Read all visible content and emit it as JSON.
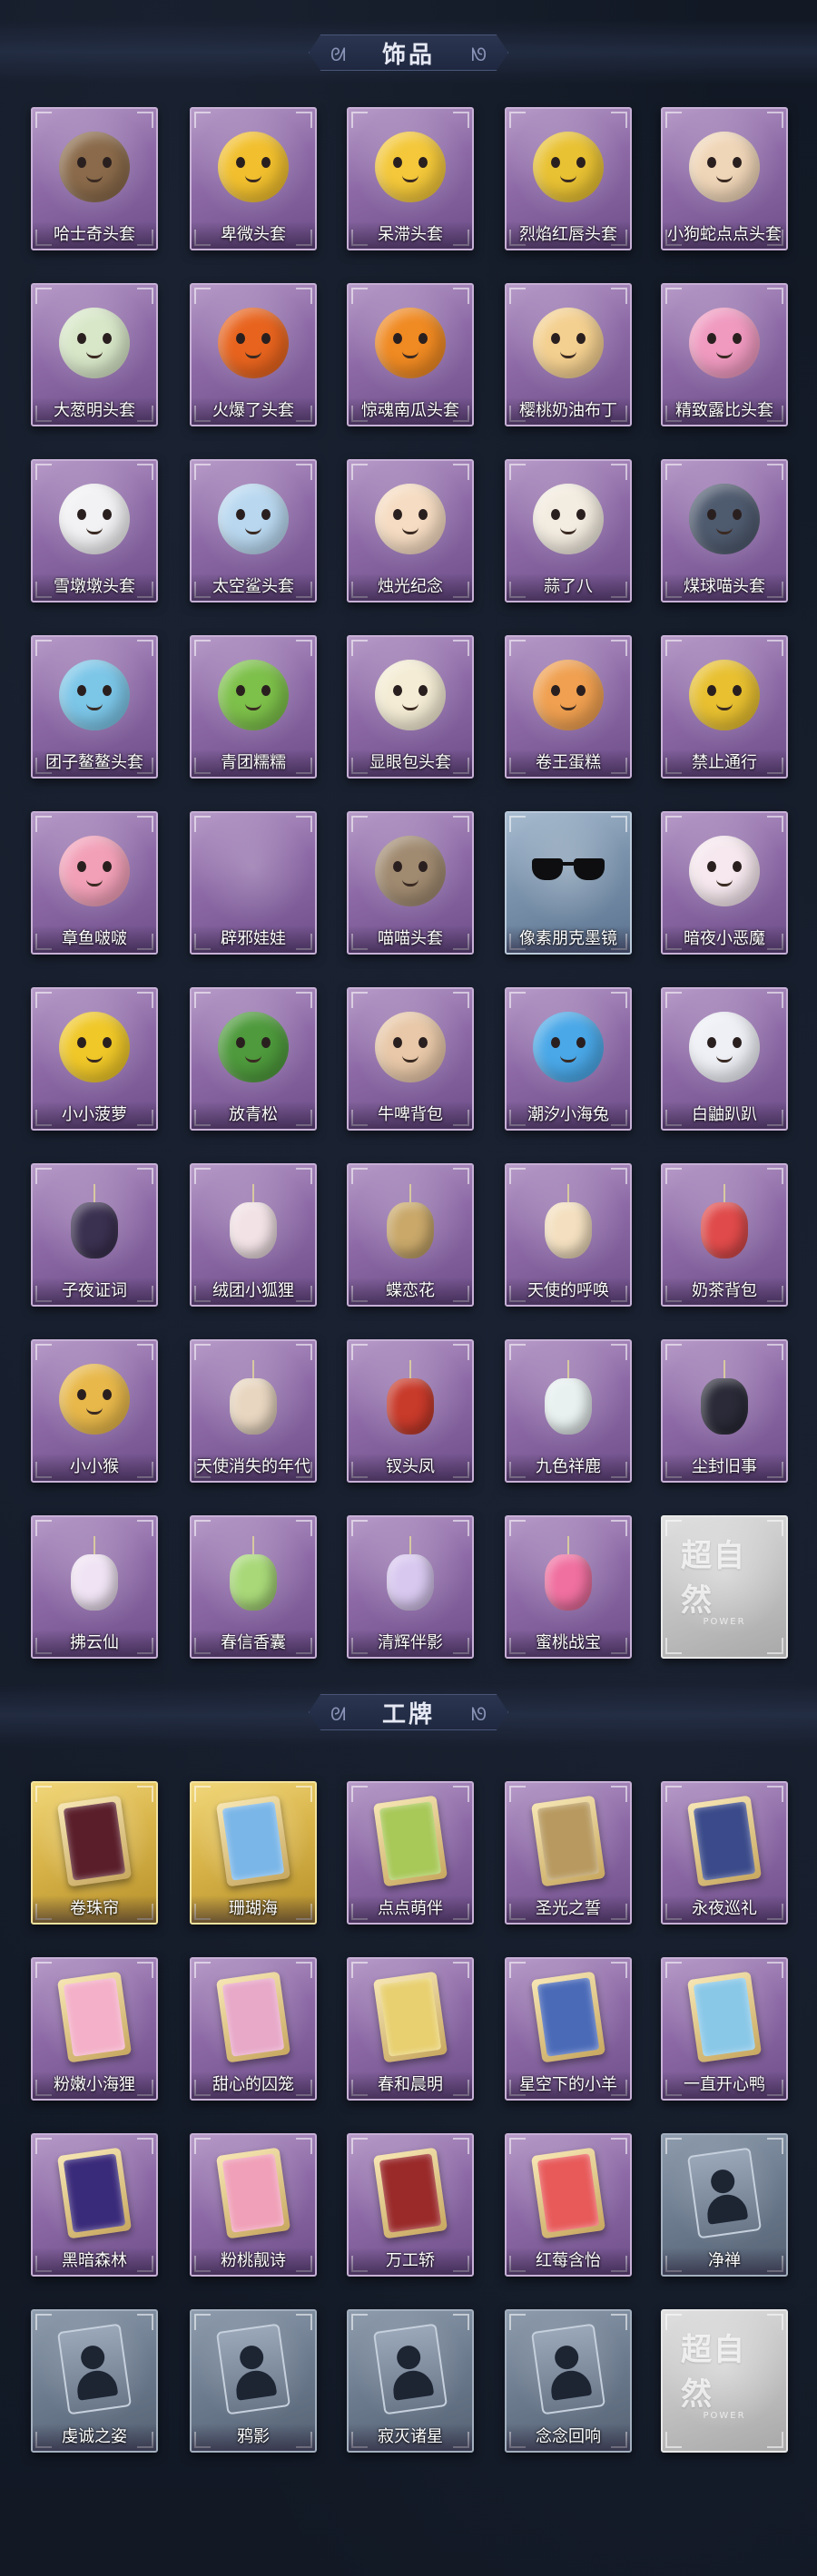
{
  "sections": {
    "accessories": {
      "title": "饰品",
      "items": [
        {
          "label": "哈士奇头套",
          "frame": "purple",
          "art": "blob",
          "color": "#8a6a4a"
        },
        {
          "label": "卑微头套",
          "frame": "purple",
          "art": "blob",
          "color": "#f2c02e"
        },
        {
          "label": "呆滞头套",
          "frame": "purple",
          "art": "blob",
          "color": "#f4c83a"
        },
        {
          "label": "烈焰红唇头套",
          "frame": "purple",
          "art": "blob",
          "color": "#e9c233"
        },
        {
          "label": "小狗蛇点点头套",
          "frame": "purple",
          "art": "blob",
          "color": "#f0d6b8"
        },
        {
          "label": "大葱明头套",
          "frame": "purple",
          "art": "blob",
          "color": "#d8e7c8"
        },
        {
          "label": "火爆了头套",
          "frame": "purple",
          "art": "blob",
          "color": "#e8641e"
        },
        {
          "label": "惊魂南瓜头套",
          "frame": "purple",
          "art": "blob",
          "color": "#f08a22"
        },
        {
          "label": "樱桃奶油布丁",
          "frame": "purple",
          "art": "blob",
          "color": "#f4d090"
        },
        {
          "label": "精致露比头套",
          "frame": "purple",
          "art": "blob",
          "color": "#f09ac0"
        },
        {
          "label": "雪墩墩头套",
          "frame": "purple",
          "art": "blob",
          "color": "#f2f2f4"
        },
        {
          "label": "太空鲨头套",
          "frame": "purple",
          "art": "blob",
          "color": "#b9d8f0"
        },
        {
          "label": "烛光纪念",
          "frame": "purple",
          "art": "blob",
          "color": "#f6dcc2"
        },
        {
          "label": "蒜了八",
          "frame": "purple",
          "art": "blob",
          "color": "#f3ece0"
        },
        {
          "label": "煤球喵头套",
          "frame": "purple",
          "art": "blob",
          "color": "#4e5a6e"
        },
        {
          "label": "团子鳌鳌头套",
          "frame": "purple",
          "art": "blob",
          "color": "#7cc6e8"
        },
        {
          "label": "青团糯糯",
          "frame": "purple",
          "art": "blob",
          "color": "#7dc04a"
        },
        {
          "label": "显眼包头套",
          "frame": "purple",
          "art": "blob",
          "color": "#f4ecd4"
        },
        {
          "label": "卷王蛋糕",
          "frame": "purple",
          "art": "blob",
          "color": "#f0a050"
        },
        {
          "label": "禁止通行",
          "frame": "purple",
          "art": "blob",
          "color": "#e8c030"
        },
        {
          "label": "章鱼啵啵",
          "frame": "purple",
          "art": "blob",
          "color": "#f2a0b8"
        },
        {
          "label": "辟邪娃娃",
          "frame": "purple",
          "art": "none",
          "color": "#a98cbf"
        },
        {
          "label": "喵喵头套",
          "frame": "purple",
          "art": "blob",
          "color": "#a08a70"
        },
        {
          "label": "像素朋克墨镜",
          "frame": "blue",
          "art": "sunglasses",
          "color": "#0e0e10"
        },
        {
          "label": "暗夜小恶魔",
          "frame": "purple",
          "art": "blob",
          "color": "#f6e8ee"
        },
        {
          "label": "小小菠萝",
          "frame": "purple",
          "art": "blob",
          "color": "#f0c828"
        },
        {
          "label": "放青松",
          "frame": "purple",
          "art": "blob",
          "color": "#4e9a3c"
        },
        {
          "label": "牛啤背包",
          "frame": "purple",
          "art": "blob",
          "color": "#e8c8a8"
        },
        {
          "label": "潮汐小海兔",
          "frame": "purple",
          "art": "blob",
          "color": "#4aa8e8"
        },
        {
          "label": "白鼬趴趴",
          "frame": "purple",
          "art": "blob",
          "color": "#eef0f6"
        },
        {
          "label": "子夜证词",
          "frame": "purple",
          "art": "pendant",
          "color": "#3a3050"
        },
        {
          "label": "绒团小狐狸",
          "frame": "purple",
          "art": "pendant",
          "color": "#f2e2e6"
        },
        {
          "label": "蝶恋花",
          "frame": "purple",
          "art": "pendant",
          "color": "#c9a86a"
        },
        {
          "label": "天使的呼唤",
          "frame": "purple",
          "art": "pendant",
          "color": "#f4e0c0"
        },
        {
          "label": "奶茶背包",
          "frame": "purple",
          "art": "pendant",
          "color": "#e04a4a"
        },
        {
          "label": "小小猴",
          "frame": "purple",
          "art": "blob",
          "color": "#e8b84a"
        },
        {
          "label": "天使消失的年代",
          "frame": "purple",
          "art": "pendant",
          "color": "#e8d6c0"
        },
        {
          "label": "钗头凤",
          "frame": "purple",
          "art": "pendant",
          "color": "#c83a2a"
        },
        {
          "label": "九色祥鹿",
          "frame": "purple",
          "art": "pendant",
          "color": "#e8f0f0"
        },
        {
          "label": "尘封旧事",
          "frame": "purple",
          "art": "pendant",
          "color": "#2a2a38"
        },
        {
          "label": "拂云仙",
          "frame": "purple",
          "art": "pendant",
          "color": "#f0e4f4"
        },
        {
          "label": "春信香囊",
          "frame": "purple",
          "art": "pendant",
          "color": "#a8d878"
        },
        {
          "label": "清辉伴影",
          "frame": "purple",
          "art": "pendant",
          "color": "#d8c8f0"
        },
        {
          "label": "蜜桃战宝",
          "frame": "purple",
          "art": "pendant",
          "color": "#f070a0"
        },
        {
          "label": "",
          "frame": "gray",
          "art": "watermark",
          "color": "#ffffff"
        }
      ]
    },
    "badges": {
      "title": "工牌",
      "items": [
        {
          "label": "卷珠帘",
          "frame": "gold",
          "art": "card",
          "color": "#5a1e2a"
        },
        {
          "label": "珊瑚海",
          "frame": "gold",
          "art": "card",
          "color": "#7ab6e8"
        },
        {
          "label": "点点萌伴",
          "frame": "purple",
          "art": "card",
          "color": "#a8c858"
        },
        {
          "label": "圣光之誓",
          "frame": "purple",
          "art": "card",
          "color": "#b89a60"
        },
        {
          "label": "永夜巡礼",
          "frame": "purple",
          "art": "card",
          "color": "#3a4a8a"
        },
        {
          "label": "粉嫩小海狸",
          "frame": "purple",
          "art": "card",
          "color": "#f4b0c8"
        },
        {
          "label": "甜心的囚笼",
          "frame": "purple",
          "art": "card",
          "color": "#e8a8c8"
        },
        {
          "label": "春和晨明",
          "frame": "purple",
          "art": "card",
          "color": "#e8d070"
        },
        {
          "label": "星空下的小羊",
          "frame": "purple",
          "art": "card",
          "color": "#4a6ab8"
        },
        {
          "label": "一直开心鸭",
          "frame": "purple",
          "art": "card",
          "color": "#8ac8e8"
        },
        {
          "label": "黑暗森林",
          "frame": "purple",
          "art": "card",
          "color": "#3a2a7a"
        },
        {
          "label": "粉桃靓诗",
          "frame": "purple",
          "art": "card",
          "color": "#f0a0b8"
        },
        {
          "label": "万工轿",
          "frame": "purple",
          "art": "card",
          "color": "#9a2a2a"
        },
        {
          "label": "红莓含怡",
          "frame": "purple",
          "art": "card",
          "color": "#e85a5a"
        },
        {
          "label": "净禅",
          "frame": "slate",
          "art": "silhouette",
          "color": "#1d2533"
        },
        {
          "label": "虔诚之姿",
          "frame": "slate",
          "art": "silhouette",
          "color": "#1d2533"
        },
        {
          "label": "鸦影",
          "frame": "slate",
          "art": "silhouette",
          "color": "#1d2533"
        },
        {
          "label": "寂灭诸星",
          "frame": "slate",
          "art": "silhouette",
          "color": "#1d2533"
        },
        {
          "label": "念念回响",
          "frame": "slate",
          "art": "silhouette",
          "color": "#1d2533"
        },
        {
          "label": "",
          "frame": "gray",
          "art": "watermark",
          "color": "#ffffff"
        }
      ]
    },
    "watermark": {
      "text": "超自然",
      "sub": "POWER"
    },
    "header_icons": {
      "left": "swirl-icon",
      "right": "swirl-icon"
    }
  }
}
